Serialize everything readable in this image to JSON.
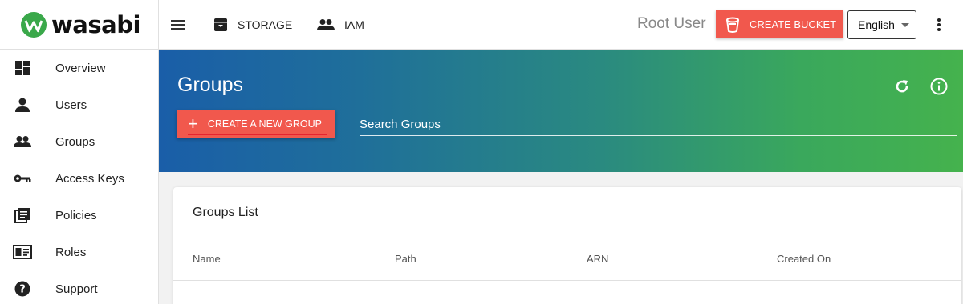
{
  "brand": {
    "name": "wasabi",
    "color": "#3aa84a"
  },
  "topnav": {
    "tabs": [
      {
        "label": "STORAGE",
        "icon": "archive-icon"
      },
      {
        "label": "IAM",
        "icon": "people-icon"
      }
    ],
    "user": "Root User",
    "create_bucket": "CREATE BUCKET",
    "language": {
      "selected": "English"
    }
  },
  "sidebar": {
    "items": [
      {
        "label": "Overview",
        "icon": "dashboard-icon"
      },
      {
        "label": "Users",
        "icon": "person-icon"
      },
      {
        "label": "Groups",
        "icon": "people-icon"
      },
      {
        "label": "Access Keys",
        "icon": "key-icon"
      },
      {
        "label": "Policies",
        "icon": "policy-document-icon"
      },
      {
        "label": "Roles",
        "icon": "id-card-icon"
      },
      {
        "label": "Support",
        "icon": "help-icon"
      }
    ]
  },
  "hero": {
    "title": "Groups",
    "create_button": "CREATE A NEW GROUP",
    "search_placeholder": "Search Groups"
  },
  "groups_list": {
    "title": "Groups List",
    "columns": [
      "Name",
      "Path",
      "ARN",
      "Created On"
    ]
  },
  "colors": {
    "accent": "#f1584d",
    "gradient_start": "#1a5ea8",
    "gradient_end": "#45b24d"
  }
}
